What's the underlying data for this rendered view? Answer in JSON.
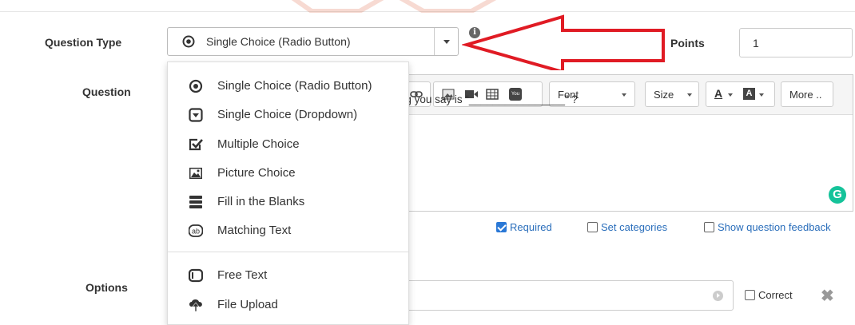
{
  "form": {
    "question_type_label": "Question Type",
    "question_label": "Question",
    "options_label": "Options",
    "points_label": "Points",
    "points_value": "1",
    "selected_type": "Single Choice (Radio Button)"
  },
  "toolbar": {
    "font_label": "Font",
    "size_label": "Size",
    "more_label": "More .."
  },
  "editor": {
    "text": "ng International Airport. The first thing you say is  “________________” ?"
  },
  "checkboxes": {
    "required": "Required",
    "set_categories": "Set categories",
    "show_feedback": "Show question feedback"
  },
  "options": {
    "correct_label": "Correct"
  },
  "dropdown": {
    "items": [
      {
        "label": "Single Choice (Radio Button)",
        "icon": "radio-icon"
      },
      {
        "label": "Single Choice (Dropdown)",
        "icon": "dropdown-icon"
      },
      {
        "label": "Multiple Choice",
        "icon": "checkbox-icon"
      },
      {
        "label": "Picture Choice",
        "icon": "picture-icon"
      },
      {
        "label": "Fill in the Blanks",
        "icon": "fill-blanks-icon"
      },
      {
        "label": "Matching Text",
        "icon": "matching-icon"
      },
      {
        "label": "Free Text",
        "icon": "free-text-icon"
      },
      {
        "label": "File Upload",
        "icon": "upload-icon"
      }
    ]
  },
  "colors": {
    "accent": "#2a78d6",
    "arrow": "#e01b24",
    "grammarly": "#15c39a"
  }
}
